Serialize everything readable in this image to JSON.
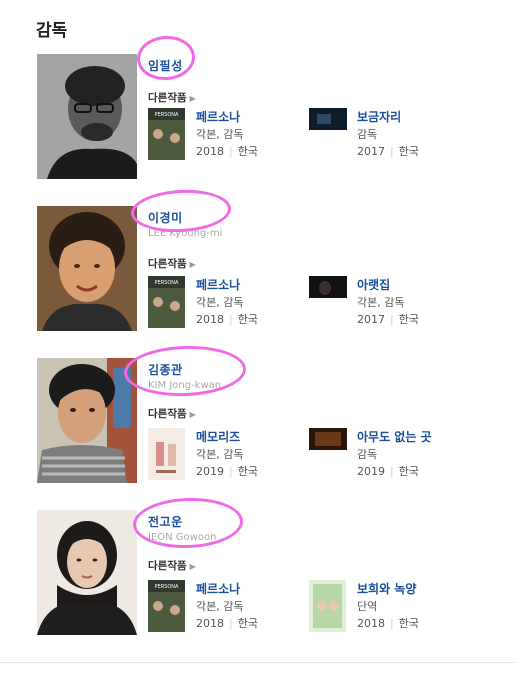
{
  "section": {
    "title": "감독"
  },
  "other_works_label": "다른작품",
  "directors": [
    {
      "name": "임필성",
      "eng": "",
      "works": [
        {
          "title": "페르소나",
          "role": "각본, 감독",
          "year": "2018",
          "country": "한국"
        },
        {
          "title": "보금자리",
          "role": "감독",
          "year": "2017",
          "country": "한국"
        }
      ]
    },
    {
      "name": "이경미",
      "eng": "LEE Kyoung-mi",
      "works": [
        {
          "title": "페르소나",
          "role": "각본, 감독",
          "year": "2018",
          "country": "한국"
        },
        {
          "title": "아랫집",
          "role": "각본, 감독",
          "year": "2017",
          "country": "한국"
        }
      ]
    },
    {
      "name": "김종관",
      "eng": "KIM Jong-kwan",
      "works": [
        {
          "title": "메모리즈",
          "role": "각본, 감독",
          "year": "2019",
          "country": "한국"
        },
        {
          "title": "아무도 없는 곳",
          "role": "감독",
          "year": "2019",
          "country": "한국"
        }
      ]
    },
    {
      "name": "전고운",
      "eng": "JEON Gowoon",
      "works": [
        {
          "title": "페르소나",
          "role": "각본, 감독",
          "year": "2018",
          "country": "한국"
        },
        {
          "title": "보희와 녹양",
          "role": "단역",
          "year": "2018",
          "country": "한국"
        }
      ]
    }
  ],
  "colors": {
    "link": "#1a4f9c",
    "highlight": "#f06ae6"
  },
  "poster_text": "PERSONA"
}
